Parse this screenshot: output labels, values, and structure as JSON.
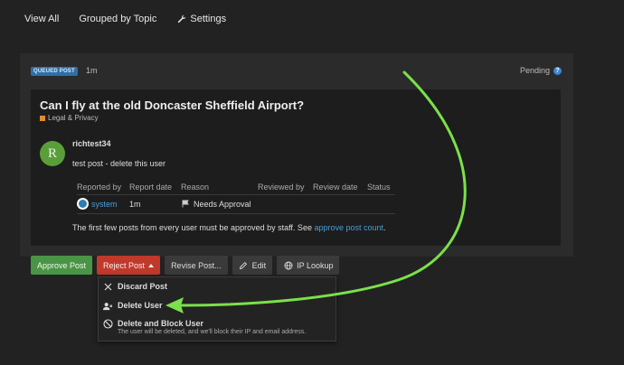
{
  "nav": {
    "view_all": "View All",
    "grouped_by_topic": "Grouped by Topic",
    "settings": "Settings"
  },
  "queue": {
    "badge": "QUEUED POST",
    "time": "1m",
    "status": "Pending"
  },
  "post": {
    "title": "Can I fly at the old Doncaster Sheffield Airport?",
    "category": "Legal & Privacy",
    "category_color": "#e08c2c",
    "avatar_letter": "R",
    "username": "richtest34",
    "body": "test post - delete this user"
  },
  "reports": {
    "headers": [
      "Reported by",
      "Report date",
      "Reason",
      "Reviewed by",
      "Review date",
      "Status"
    ],
    "row": {
      "reported_by": "system",
      "report_date": "1m",
      "reason": "Needs Approval"
    }
  },
  "note": {
    "text": "The first few posts from every user must be approved by staff. See ",
    "link": "approve post count",
    "end": "."
  },
  "actions": {
    "approve": "Approve Post",
    "reject": "Reject Post",
    "revise": "Revise Post...",
    "edit": "Edit",
    "ip_lookup": "IP Lookup"
  },
  "menu": {
    "discard": "Discard Post",
    "delete_user": "Delete User",
    "delete_block": "Delete and Block User",
    "delete_block_desc": "The user will be deleted, and we'll block their IP and email address."
  },
  "colors": {
    "approve": "#4a9545",
    "reject": "#c0392b",
    "link": "#4a9ed8",
    "badge": "#2e6fa8",
    "arrow": "#7be04a"
  }
}
